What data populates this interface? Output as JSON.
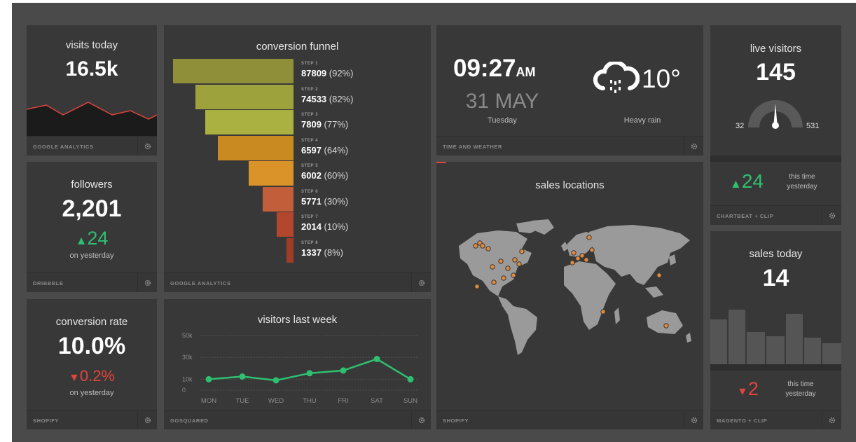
{
  "visits": {
    "title": "visits today",
    "value": "16.5k",
    "source": "GOOGLE ANALYTICS"
  },
  "followers": {
    "title": "followers",
    "value": "2,201",
    "delta": "24",
    "sub": "on yesterday",
    "source": "DRIBBBLE"
  },
  "conversion": {
    "title": "conversion rate",
    "value": "10.0%",
    "delta": "0.2%",
    "sub": "on yesterday",
    "source": "SHOPIFY"
  },
  "funnel": {
    "title": "conversion funnel",
    "source": "GOOGLE ANALYTICS",
    "steps": [
      {
        "label": "STEP 1",
        "value": "87809",
        "pct": "(92%)",
        "color": "#8f8f3a"
      },
      {
        "label": "STEP 2",
        "value": "74533",
        "pct": "(82%)",
        "color": "#9da23c"
      },
      {
        "label": "STEP 3",
        "value": "7809",
        "pct": "(77%)",
        "color": "#abb140"
      },
      {
        "label": "STEP 4",
        "value": "6597",
        "pct": "(64%)",
        "color": "#c98a22"
      },
      {
        "label": "STEP 5",
        "value": "6002",
        "pct": "(60%)",
        "color": "#d99328"
      },
      {
        "label": "STEP 6",
        "value": "5771",
        "pct": "(30%)",
        "color": "#c25e3a"
      },
      {
        "label": "STEP 7",
        "value": "2014",
        "pct": "(10%)",
        "color": "#b2472e"
      },
      {
        "label": "STEP 8",
        "value": "1337",
        "pct": "(8%)",
        "color": "#9e3c28"
      }
    ]
  },
  "weekly": {
    "title": "visitors last week",
    "source": "GOSQUARED",
    "chart_data": {
      "type": "line",
      "categories": [
        "MON",
        "TUE",
        "WED",
        "THU",
        "FRI",
        "SAT",
        "SUN"
      ],
      "values": [
        10000,
        12500,
        9000,
        15500,
        18000,
        28500,
        10000
      ],
      "y_ticks": [
        "50k",
        "30k",
        "10k",
        "0"
      ],
      "ylim": [
        0,
        50000
      ],
      "color": "#2fbf71"
    }
  },
  "time": {
    "clock": "09:27",
    "ampm": "AM",
    "date": "31 MAY",
    "weekday": "Tuesday",
    "temp": "10°",
    "condition": "Heavy rain",
    "source": "TIME AND WEATHER"
  },
  "map": {
    "title": "sales locations",
    "source": "SHOPIFY"
  },
  "live": {
    "title": "live visitors",
    "value": "145",
    "min": "32",
    "max": "531",
    "delta": "24",
    "delta_label": "this time yesterday",
    "source": "CHARTBEAT + CLIP"
  },
  "sales": {
    "title": "sales today",
    "value": "14",
    "delta": "2",
    "delta_label": "this time yesterday",
    "source": "MAGENTO + CLIP"
  },
  "colors": {
    "accent_green": "#2fbf71",
    "accent_red": "#e0443e",
    "panel": "#383838",
    "background": "#4a4a4a"
  }
}
